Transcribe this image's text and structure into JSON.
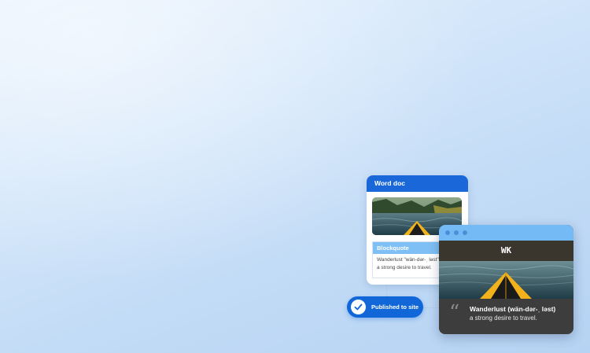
{
  "word_doc": {
    "title": "Word doc",
    "blockquote_label": "Blockquote",
    "blockquote_line1": "Wanderlust \"wän-dər-ˌ lәst\"",
    "blockquote_line2": "a strong desire to travel."
  },
  "publish": {
    "label": "Published to site",
    "icon": "checkmark-icon"
  },
  "website": {
    "logo": "WK",
    "quote_title": "Wanderlust (wän-dər-ˌ lәst)",
    "quote_subtitle": "a strong desire to travel."
  },
  "colors": {
    "brand_blue": "#1267d8",
    "light_blue": "#7ec0f5",
    "dark_panel": "#3d3d3d"
  }
}
